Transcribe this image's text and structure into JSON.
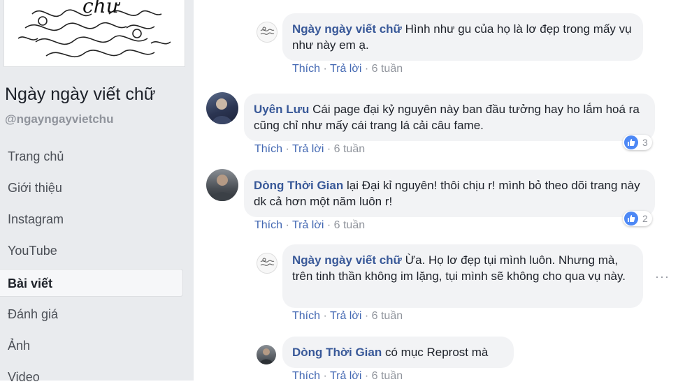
{
  "sidebar": {
    "cover_text": "chữ",
    "page_name": "Ngày ngày viết chữ",
    "page_handle": "@ngayngayvietchu",
    "nav": [
      {
        "label": "Trang chủ",
        "active": false
      },
      {
        "label": "Giới thiệu",
        "active": false
      },
      {
        "label": "Instagram",
        "active": false
      },
      {
        "label": "YouTube",
        "active": false
      },
      {
        "label": "Bài viết",
        "active": true
      },
      {
        "label": "Đánh giá",
        "active": false
      },
      {
        "label": "Ảnh",
        "active": false
      },
      {
        "label": "Video",
        "active": false
      }
    ]
  },
  "comments": [
    {
      "author": "Ngày ngày viết chữ",
      "text": "Hình như gu của họ là lơ đẹp trong mấy vụ như này em ạ.",
      "like": "Thích",
      "reply": "Trả lời",
      "time": "6 tuần",
      "avatar": "page-logo"
    },
    {
      "author": "Uyên Lưu",
      "text": "Cái page đại kỷ nguyên này ban đầu tưởng hay ho lắm hoá ra cũng chỉ như mấy cái trang lá cải câu fame.",
      "like": "Thích",
      "reply": "Trả lời",
      "time": "6 tuần",
      "reactions": "3",
      "avatar": "user-photo"
    },
    {
      "author": "Dòng Thời Gian",
      "text": "lại Đại kỉ nguyên! thôi chịu r! mình bỏ theo dõi trang này dk cả hơn một năm luôn r!",
      "like": "Thích",
      "reply": "Trả lời",
      "time": "6 tuần",
      "reactions": "2",
      "avatar": "user-photo"
    },
    {
      "author": "Ngày ngày viết chữ",
      "text": "Ừa. Họ lơ đẹp tụi mình luôn. Nhưng mà, trên tinh thần không im lặng, tụi mình sẽ không cho qua vụ này.",
      "like": "Thích",
      "reply": "Trả lời",
      "time": "6 tuần",
      "avatar": "page-logo"
    },
    {
      "author": "Dòng Thời Gian",
      "text": "có mục Reprost mà",
      "like": "Thích",
      "reply": "Trả lời",
      "time": "6 tuần",
      "avatar": "user-photo"
    }
  ],
  "more_options": "···",
  "colors": {
    "link": "#385898",
    "action_link": "#4267b2",
    "bubble": "#f2f3f5",
    "sidebar_bg": "#e9ebee",
    "like_blue": "#4d88f5"
  }
}
